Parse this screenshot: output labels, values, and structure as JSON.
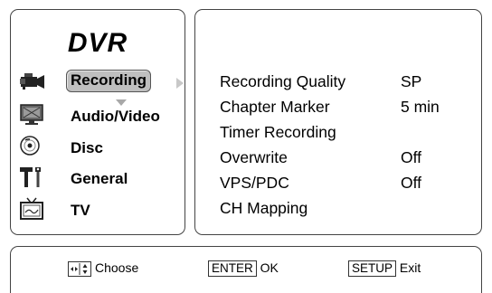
{
  "menu": {
    "title": "DVR",
    "items": [
      {
        "label": "Recording",
        "icon": "camcorder-icon",
        "selected": true
      },
      {
        "label": "Audio/Video",
        "icon": "monitor-icon",
        "selected": false
      },
      {
        "label": "Disc",
        "icon": "disc-icon",
        "selected": false
      },
      {
        "label": "General",
        "icon": "tools-icon",
        "selected": false
      },
      {
        "label": "TV",
        "icon": "tv-icon",
        "selected": false
      }
    ]
  },
  "settings": {
    "rows": [
      {
        "label": "Recording Quality",
        "value": "SP"
      },
      {
        "label": "Chapter Marker",
        "value": "5 min"
      },
      {
        "label": "Timer Recording",
        "value": ""
      },
      {
        "label": "Overwrite",
        "value": "Off"
      },
      {
        "label": "VPS/PDC",
        "value": "Off"
      },
      {
        "label": "CH Mapping",
        "value": ""
      }
    ]
  },
  "footer": {
    "choose_label": "Choose",
    "enter_key": "ENTER",
    "enter_label": "OK",
    "setup_key": "SETUP",
    "setup_label": "Exit"
  },
  "colors": {
    "selected_bg": "#bfbfbf",
    "border": "#444444"
  }
}
